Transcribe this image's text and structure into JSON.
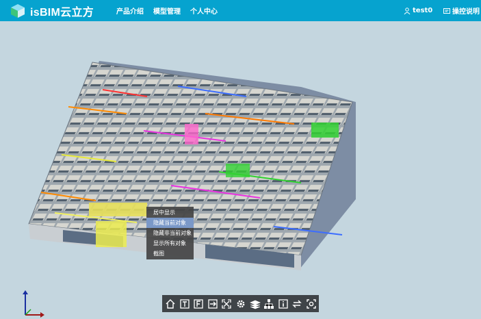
{
  "app": {
    "title": "isBIM云立方",
    "brand_color": "#06a3cf"
  },
  "nav": {
    "items": [
      "产品介绍",
      "模型管理",
      "个人中心"
    ]
  },
  "user": {
    "name": "test0",
    "icon": "user-icon"
  },
  "help": {
    "label": "操控说明",
    "icon": "help-icon"
  },
  "context_menu": {
    "items": [
      "居中显示",
      "隐藏当前对象",
      "隐藏非当前对象",
      "显示所有对象",
      "截图"
    ],
    "active_index": 1
  },
  "toolbar": {
    "icons": [
      "home-icon",
      "top-view-icon",
      "front-view-icon",
      "section-icon",
      "fullscreen-icon",
      "settings-icon",
      "layers-icon",
      "tree-icon",
      "info-icon",
      "swap-icon",
      "screenshot-icon"
    ]
  }
}
